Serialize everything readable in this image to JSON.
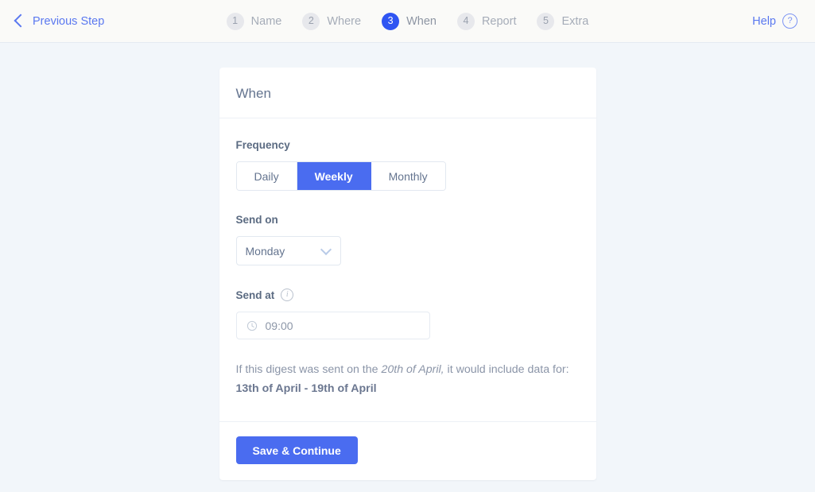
{
  "topbar": {
    "previous_step_label": "Previous Step",
    "back_icon": "chevron-left-icon",
    "help_label": "Help",
    "help_icon_glyph": "?",
    "steps": [
      {
        "num": "1",
        "label": "Name",
        "active": false
      },
      {
        "num": "2",
        "label": "Where",
        "active": false
      },
      {
        "num": "3",
        "label": "When",
        "active": true
      },
      {
        "num": "4",
        "label": "Report",
        "active": false
      },
      {
        "num": "5",
        "label": "Extra",
        "active": false
      }
    ]
  },
  "card": {
    "title": "When",
    "frequency": {
      "label": "Frequency",
      "options": [
        "Daily",
        "Weekly",
        "Monthly"
      ],
      "selected": "Weekly"
    },
    "send_on": {
      "label": "Send on",
      "value": "Monday",
      "chevron_icon": "chevron-down-icon"
    },
    "send_at": {
      "label": "Send at",
      "info_icon": "info-icon",
      "info_glyph": "i",
      "clock_icon": "clock-icon",
      "value": "09:00"
    },
    "summary": {
      "prefix": "If this digest was sent on the ",
      "emphasis": "20th of April,",
      "suffix": " it would include data for:",
      "range": "13th of April - 19th of April"
    },
    "save_label": "Save & Continue"
  },
  "colors": {
    "accent": "#4a6cf0",
    "active_step": "#2f55f2",
    "link": "#5a78f0",
    "page_bg": "#f2f6fa",
    "topbar_bg": "#fafaf8",
    "card_bg": "#ffffff"
  }
}
